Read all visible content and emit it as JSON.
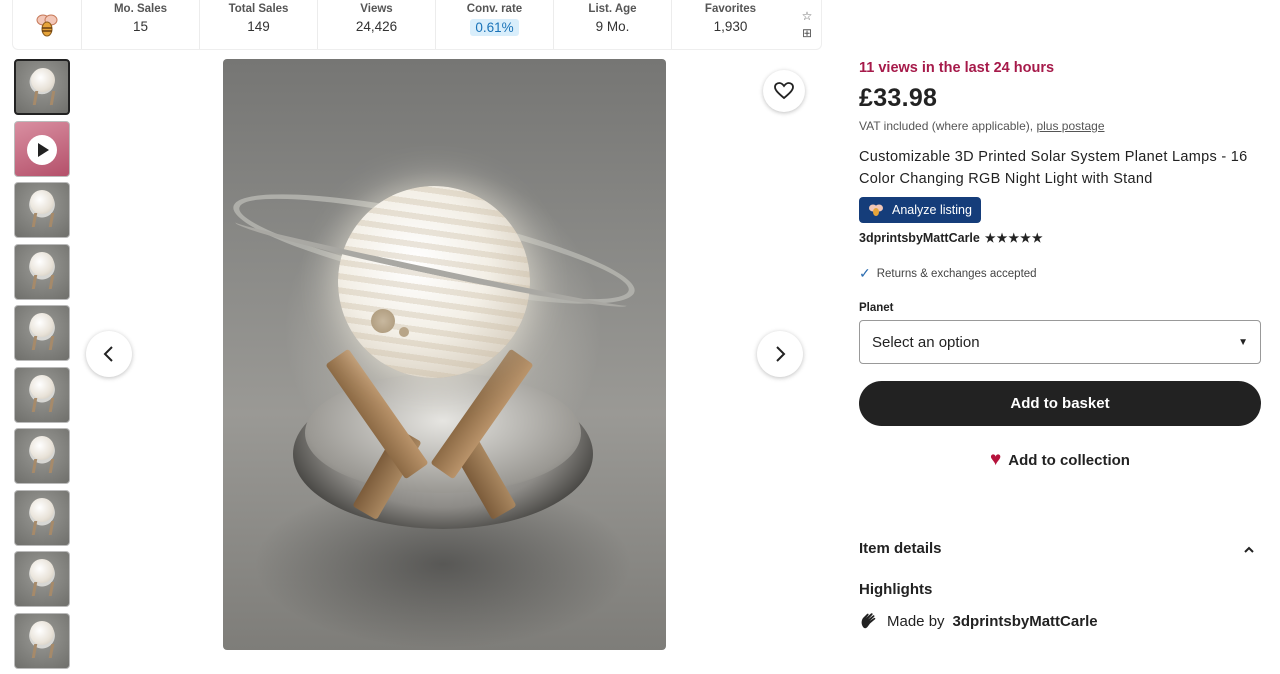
{
  "stats": {
    "mo_sales_label": "Mo. Sales",
    "mo_sales_value": "15",
    "total_sales_label": "Total Sales",
    "total_sales_value": "149",
    "views_label": "Views",
    "views_value": "24,426",
    "conv_rate_label": "Conv. rate",
    "conv_rate_value": "0.61%",
    "list_age_label": "List. Age",
    "list_age_value": "9 Mo.",
    "favorites_label": "Favorites",
    "favorites_value": "1,930"
  },
  "gallery": {
    "thumbnail_count": 10,
    "active_index": 0,
    "video_index": 1
  },
  "listing": {
    "views_notice": "11 views in the last 24 hours",
    "price": "£33.98",
    "vat_text": "VAT included (where applicable),",
    "postage_link": "plus postage",
    "title": "Customizable 3D Printed Solar System Planet Lamps - 16 Color Changing RGB Night Light with Stand",
    "analyze_label": "Analyze listing",
    "seller": "3dprintsbyMattCarle",
    "rating_stars": "★★★★★",
    "returns_text": "Returns & exchanges accepted",
    "planet_label": "Planet",
    "planet_select_value": "Select an option",
    "add_to_basket": "Add to basket",
    "add_to_collection": "Add to collection",
    "item_details": "Item details",
    "highlights": "Highlights",
    "made_by_prefix": "Made by",
    "made_by_seller": "3dprintsbyMattCarle"
  },
  "colors": {
    "views_notice": "#a61a4a",
    "analyze_button": "#153d7a",
    "basket_button": "#222222",
    "collection_heart": "#b5133c",
    "conv_rate_pill": "#d9eefb"
  }
}
